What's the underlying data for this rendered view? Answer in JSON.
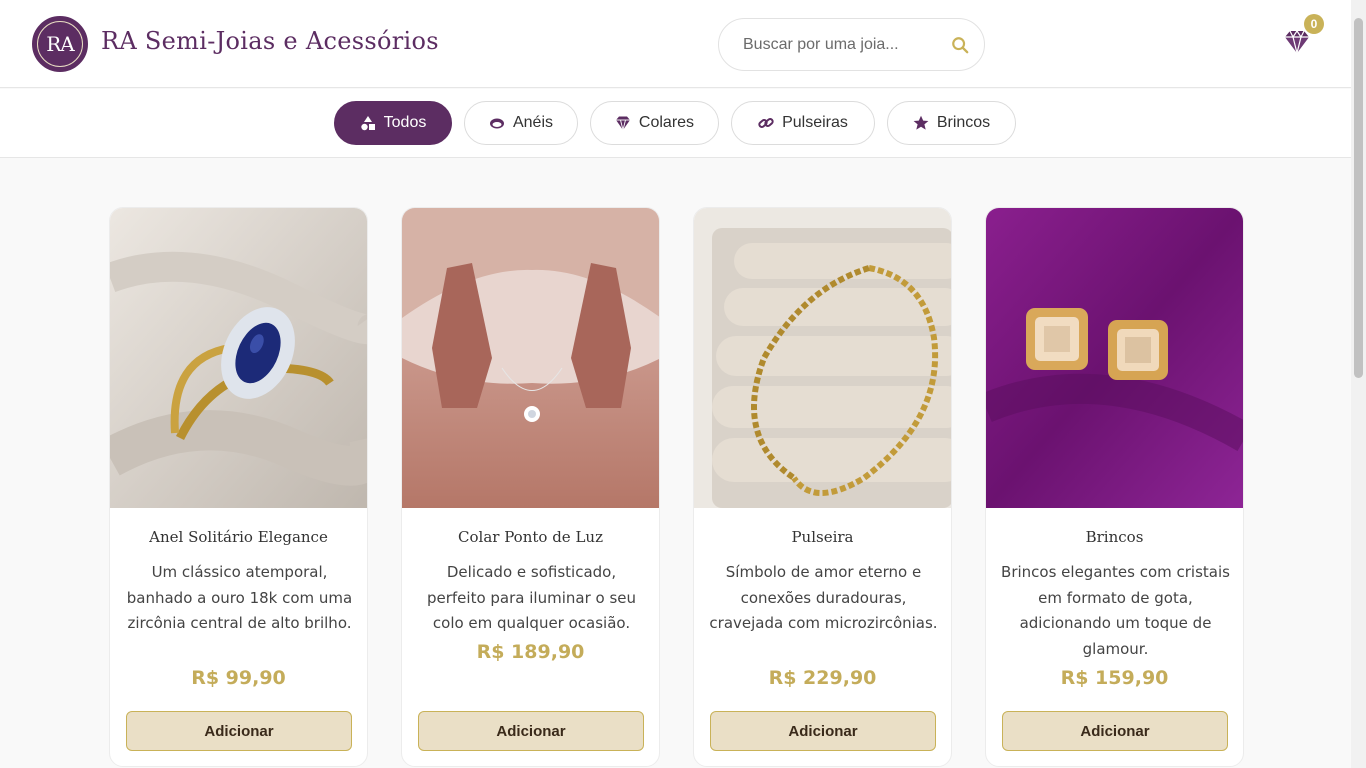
{
  "header": {
    "logo_text": "RA",
    "title": "RA Semi-Joias e Acessórios",
    "search_placeholder": "Buscar por uma joia...",
    "cart_count": "0"
  },
  "filters": [
    {
      "label": "Todos",
      "icon": "shapes-icon",
      "active": true
    },
    {
      "label": "Anéis",
      "icon": "ring-icon",
      "active": false
    },
    {
      "label": "Colares",
      "icon": "gem-icon",
      "active": false
    },
    {
      "label": "Pulseiras",
      "icon": "link-icon",
      "active": false
    },
    {
      "label": "Brincos",
      "icon": "star-icon",
      "active": false
    }
  ],
  "products": [
    {
      "name": "Anel Solitário Elegance",
      "description": "Um clássico atemporal, banhado a ouro 18k com uma zircônia central de alto brilho.",
      "price": "R$ 99,90",
      "button": "Adicionar"
    },
    {
      "name": "Colar Ponto de Luz",
      "description": "Delicado e sofisticado, perfeito para iluminar o seu colo em qualquer ocasião.",
      "price": "R$ 189,90",
      "button": "Adicionar"
    },
    {
      "name": "Pulseira",
      "description": "Símbolo de amor eterno e conexões duradouras, cravejada com microzircônias.",
      "price": "R$ 229,90",
      "button": "Adicionar"
    },
    {
      "name": "Brincos",
      "description": "Brincos elegantes com cristais em formato de gota, adicionando um toque de glamour.",
      "price": "R$ 159,90",
      "button": "Adicionar"
    }
  ],
  "colors": {
    "brand": "#5c2d62",
    "gold": "#c4ac5a",
    "button_bg": "#eadfc6"
  }
}
